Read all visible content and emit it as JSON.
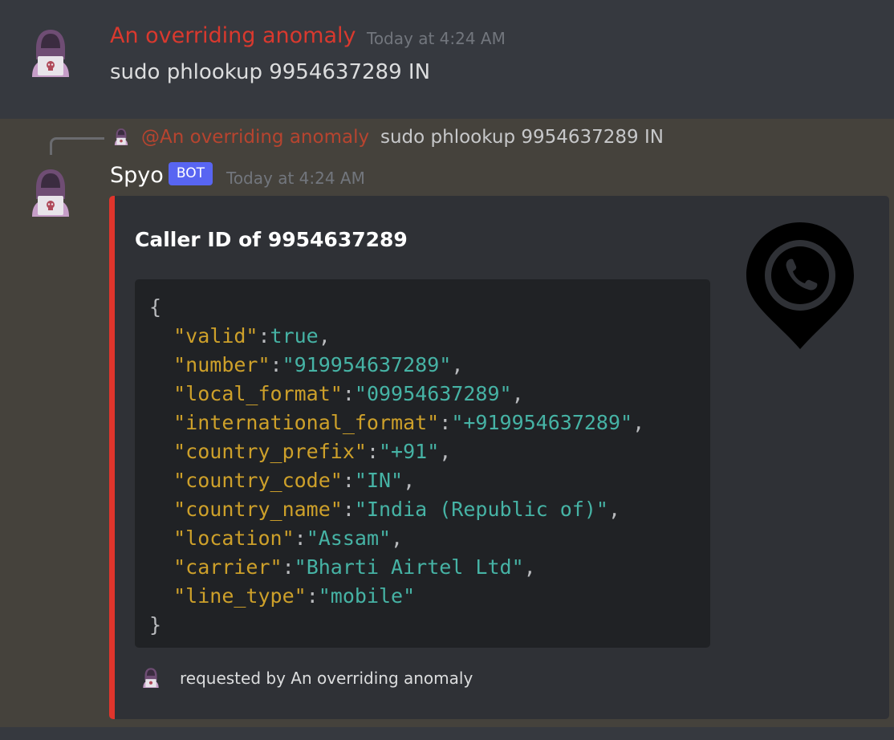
{
  "message1": {
    "author": "An overriding anomaly",
    "timestamp": "Today at 4:24 AM",
    "content": "sudo phlookup 9954637289 IN"
  },
  "message2": {
    "reply": {
      "mention": "@An overriding anomaly",
      "content": "sudo phlookup 9954637289 IN"
    },
    "author": "Spyo",
    "badge": "BOT",
    "timestamp": "Today at 4:24 AM",
    "embed": {
      "title": "Caller ID of 9954637289",
      "accent_color": "#e0352c",
      "thumbnail_icon": "phone-location-pin-icon",
      "code": {
        "open": "{",
        "close": "}",
        "lines": [
          {
            "key": "\"valid\"",
            "value": "true",
            "comma": ","
          },
          {
            "key": "\"number\"",
            "value": "\"919954637289\"",
            "comma": ","
          },
          {
            "key": "\"local_format\"",
            "value": "\"09954637289\"",
            "comma": ","
          },
          {
            "key": "\"international_format\"",
            "value": "\"+919954637289\"",
            "comma": ","
          },
          {
            "key": "\"country_prefix\"",
            "value": "\"+91\"",
            "comma": ","
          },
          {
            "key": "\"country_code\"",
            "value": "\"IN\"",
            "comma": ","
          },
          {
            "key": "\"country_name\"",
            "value": "\"India (Republic of)\"",
            "comma": ","
          },
          {
            "key": "\"location\"",
            "value": "\"Assam\"",
            "comma": ","
          },
          {
            "key": "\"carrier\"",
            "value": "\"Bharti Airtel Ltd\"",
            "comma": ","
          },
          {
            "key": "\"line_type\"",
            "value": "\"mobile\"",
            "comma": ""
          }
        ]
      },
      "footer": "requested by An overriding anomaly"
    }
  },
  "colors": {
    "background": "#36393f",
    "highlight_background": "#45423c",
    "embed_background": "#2f3136",
    "code_background": "#202225",
    "author_red": "#d9392e",
    "bot_badge": "#5865f2",
    "json_key": "#cda02a",
    "json_value": "#46b3a5"
  }
}
